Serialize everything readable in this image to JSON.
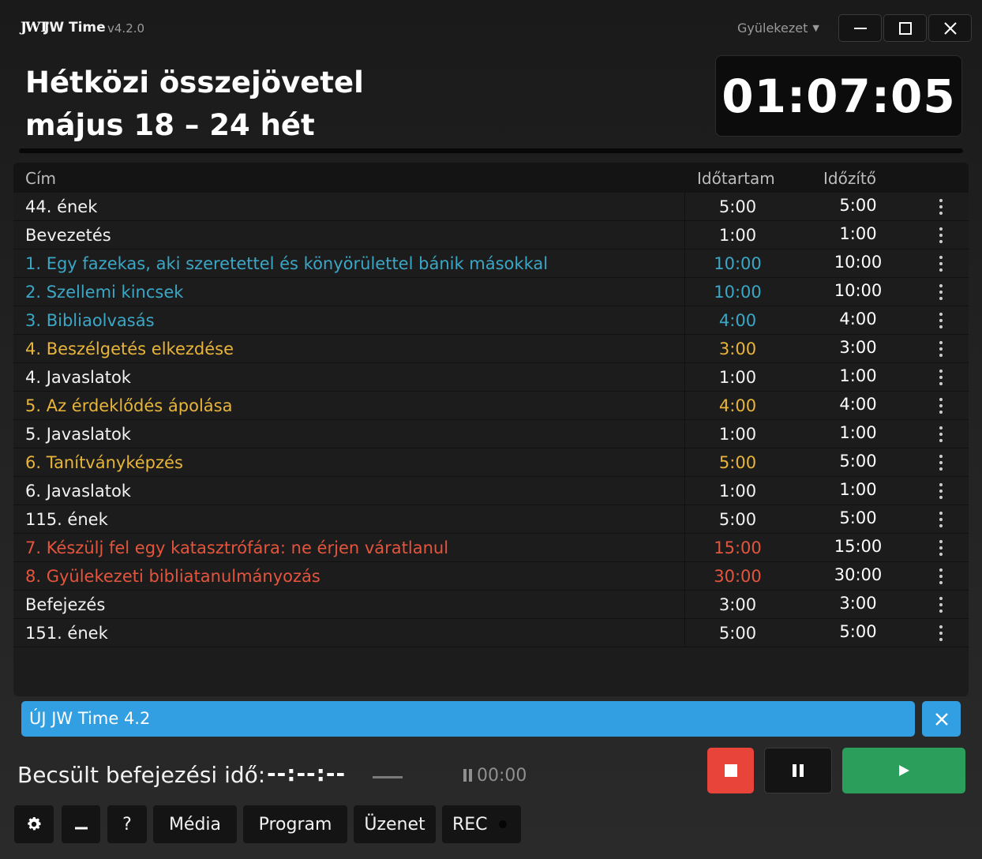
{
  "window": {
    "logo": "JWT",
    "app_title": "JW Time",
    "version": "v4.2.0",
    "congregation": "Gyülekezet"
  },
  "header": {
    "title_line1": "Hétközi összejövetel",
    "title_line2": "május 18 – 24 hét",
    "clock": "01:07:05"
  },
  "table": {
    "col_title": "Cím",
    "col_duration": "Időtartam",
    "col_timer": "Időzítő",
    "rows": [
      {
        "title": "44. ének",
        "duration": "5:00",
        "timer": "5:00",
        "color": "#f2f2f2"
      },
      {
        "title": "Bevezetés",
        "duration": "1:00",
        "timer": "1:00",
        "color": "#f2f2f2"
      },
      {
        "title": "1. Egy fazekas, aki szeretettel és könyörülettel bánik másokkal",
        "duration": "10:00",
        "timer": "10:00",
        "color": "#3ba7c6"
      },
      {
        "title": "2. Szellemi kincsek",
        "duration": "10:00",
        "timer": "10:00",
        "color": "#3ba7c6"
      },
      {
        "title": "3. Bibliaolvasás",
        "duration": "4:00",
        "timer": "4:00",
        "color": "#3ba7c6"
      },
      {
        "title": "4. Beszélgetés elkezdése",
        "duration": "3:00",
        "timer": "3:00",
        "color": "#e8b53a"
      },
      {
        "title": "4. Javaslatok",
        "duration": "1:00",
        "timer": "1:00",
        "color": "#f2f2f2"
      },
      {
        "title": "5. Az érdeklődés ápolása",
        "duration": "4:00",
        "timer": "4:00",
        "color": "#e8b53a"
      },
      {
        "title": "5. Javaslatok",
        "duration": "1:00",
        "timer": "1:00",
        "color": "#f2f2f2"
      },
      {
        "title": "6. Tanítványképzés",
        "duration": "5:00",
        "timer": "5:00",
        "color": "#e8b53a"
      },
      {
        "title": "6. Javaslatok",
        "duration": "1:00",
        "timer": "1:00",
        "color": "#f2f2f2"
      },
      {
        "title": "115. ének",
        "duration": "5:00",
        "timer": "5:00",
        "color": "#f2f2f2"
      },
      {
        "title": "7. Készülj fel egy katasztrófára: ne érjen váratlanul",
        "duration": "15:00",
        "timer": "15:00",
        "color": "#e3553d"
      },
      {
        "title": "8. Gyülekezeti bibliatanulmányozás",
        "duration": "30:00",
        "timer": "30:00",
        "color": "#e3553d"
      },
      {
        "title": "Befejezés",
        "duration": "3:00",
        "timer": "3:00",
        "color": "#f2f2f2"
      },
      {
        "title": "151. ének",
        "duration": "5:00",
        "timer": "5:00",
        "color": "#f2f2f2"
      }
    ]
  },
  "notice": {
    "text": "ÚJ JW Time 4.2"
  },
  "status": {
    "eta_label": "Becsült befejezési idő:",
    "eta_value": "--:--:--",
    "paused_time": "00:00"
  },
  "toolbar": {
    "media": "Média",
    "program": "Program",
    "message": "Üzenet",
    "rec": "REC",
    "help": "?"
  },
  "icons": {
    "settings": "gear-icon",
    "minimize": "minimize-icon",
    "stop": "stop-icon",
    "pause": "pause-icon",
    "play": "play-icon",
    "close": "close-icon"
  },
  "colors": {
    "accent_blue": "#329fe3",
    "stop_red": "#e9443a",
    "play_green": "#2a9e5a",
    "teal": "#3ba7c6",
    "gold": "#e8b53a",
    "red": "#e3553d"
  }
}
